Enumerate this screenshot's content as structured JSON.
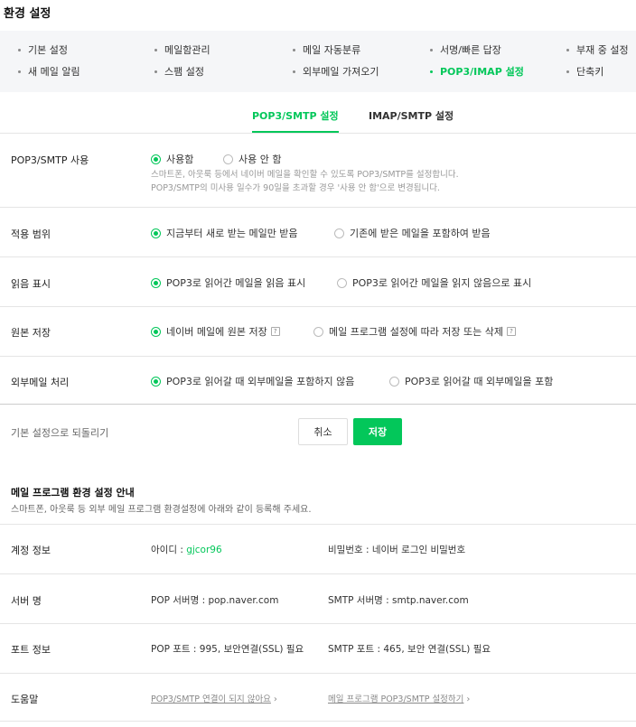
{
  "page": {
    "title": "환경 설정"
  },
  "menu": {
    "items": [
      "기본 설정",
      "메일함관리",
      "메일 자동분류",
      "서명/빠른 답장",
      "부재 중 설정",
      "새 메일 알림",
      "스팸 설정",
      "외부메일 가져오기",
      "POP3/IMAP 설정",
      "단축키"
    ],
    "active_index": 8
  },
  "tabs": {
    "pop3": "POP3/SMTP 설정",
    "imap": "IMAP/SMTP 설정"
  },
  "settings": {
    "usage": {
      "label": "POP3/SMTP 사용",
      "opt_on": "사용함",
      "opt_off": "사용 안 함",
      "desc1": "스마트폰, 아웃룩 등에서 네이버 메일을 확인할 수 있도록 POP3/SMTP를 설정합니다.",
      "desc2": "POP3/SMTP의 미사용 일수가 90일을 초과할 경우 '사용 안 함'으로 변경됩니다."
    },
    "scope": {
      "label": "적용 범위",
      "opt1": "지금부터 새로 받는 메일만 받음",
      "opt2": "기존에 받은 메일을 포함하여 받음"
    },
    "read": {
      "label": "읽음 표시",
      "opt1": "POP3로 읽어간 메일을 읽음 표시",
      "opt2": "POP3로 읽어간 메일을 읽지 않음으로 표시"
    },
    "keep": {
      "label": "원본 저장",
      "opt1": "네이버 메일에 원본 저장",
      "opt2": "메일 프로그램 설정에 따라 저장 또는 삭제",
      "help": "?"
    },
    "external": {
      "label": "외부메일 처리",
      "opt1": "POP3로 읽어갈 때 외부메일을 포함하지 않음",
      "opt2": "POP3로 읽어갈 때 외부메일을 포함"
    }
  },
  "actions": {
    "reset": "기본 설정으로 되돌리기",
    "cancel": "취소",
    "save": "저장"
  },
  "guide": {
    "title": "메일 프로그램 환경 설정 안내",
    "desc": "스마트폰, 아웃룩 등 외부 메일 프로그램 환경설정에 아래와 같이 등록해 주세요.",
    "rows": {
      "account": {
        "label": "계정 정보",
        "id_prefix": "아이디 : ",
        "id_value": "gjcor96",
        "pw": "비밀번호 : 네이버 로그인 비밀번호"
      },
      "server": {
        "label": "서버 명",
        "pop": "POP 서버명 : pop.naver.com",
        "smtp": "SMTP 서버명 : smtp.naver.com"
      },
      "port": {
        "label": "포트 정보",
        "pop": "POP 포트 : 995, 보안연결(SSL) 필요",
        "smtp": "SMTP 포트 : 465, 보안 연결(SSL) 필요"
      },
      "help": {
        "label": "도움말",
        "link1": "POP3/SMTP 연결이 되지 않아요",
        "link2": "메일 프로그램 POP3/SMTP 설정하기"
      }
    }
  },
  "colors": {
    "accent": "#03c75a"
  }
}
